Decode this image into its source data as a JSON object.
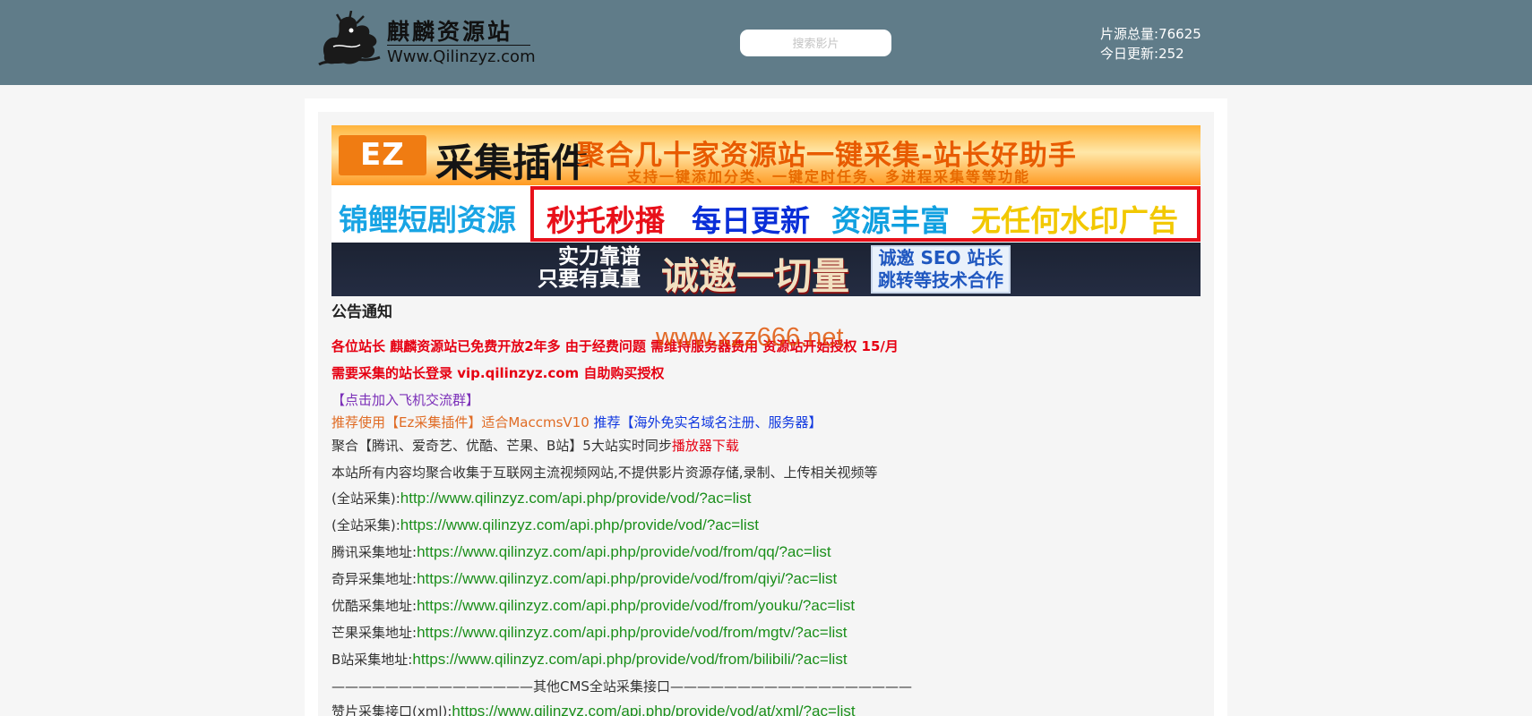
{
  "header": {
    "logo": {
      "title": "麒麟资源站",
      "url": "Www.Qilinzyz.com",
      "icon": "dragon-icon"
    },
    "search": {
      "placeholder": "搜索影片"
    },
    "stats": {
      "total_label": "片源总量:",
      "total_value": "76625",
      "today_label": "今日更新:",
      "today_value": "252"
    }
  },
  "banners": {
    "ez": {
      "logo_text": "EZ",
      "title": "采集插件",
      "slogan": "聚合几十家资源站一键采集-站长好助手",
      "subtitle": "支持一键添加分类、一键定时任务、多进程采集等等功能"
    },
    "jinli": {
      "name": "锦鲤短剧资源",
      "seg1": "秒托秒播",
      "seg2": "每日更新",
      "seg3": "资源丰富",
      "seg4": "无任何水印广告"
    },
    "shili": {
      "line1": "实力靠谱",
      "line2": "只要有真量",
      "main": "诚邀一切量",
      "box_line1": "诚邀 SEO 站长",
      "box_line2": "跳转等技术合作"
    }
  },
  "notice": {
    "title": "公告通知",
    "watermark": "www.xzz666.net",
    "line1": "各位站长 麒麟资源站已免费开放2年多 由于经费问题 需维持服务器费用 资源站开始授权 15/月",
    "line2": "需要采集的站长登录 vip.qilinzyz.com 自助购买授权",
    "telegram_link": "【点击加入飞机交流群】",
    "recommend_ez": "推荐使用【Ez采集插件】适合MaccmsV10",
    "recommend_domain": "推荐【海外免实名域名注册、服务器】",
    "sync_text": "聚合【腾讯、爱奇艺、优酷、芒果、B站】5大站实时同步",
    "player_download": "播放器下载",
    "disclaimer": "本站所有内容均聚合收集于互联网主流视频网站,不提供影片资源存储,录制、上传相关视频等"
  },
  "api_list": [
    {
      "label": "(全站采集):",
      "url": "http://www.qilinzyz.com/api.php/provide/vod/?ac=list"
    },
    {
      "label": "(全站采集):",
      "url": "https://www.qilinzyz.com/api.php/provide/vod/?ac=list"
    },
    {
      "label": "腾讯采集地址:",
      "url": "https://www.qilinzyz.com/api.php/provide/vod/from/qq/?ac=list"
    },
    {
      "label": "奇异采集地址:",
      "url": "https://www.qilinzyz.com/api.php/provide/vod/from/qiyi/?ac=list"
    },
    {
      "label": "优酷采集地址:",
      "url": "https://www.qilinzyz.com/api.php/provide/vod/from/youku/?ac=list"
    },
    {
      "label": "芒果采集地址:",
      "url": "https://www.qilinzyz.com/api.php/provide/vod/from/mgtv/?ac=list"
    },
    {
      "label": "B站采集地址:",
      "url": "https://www.qilinzyz.com/api.php/provide/vod/from/bilibili/?ac=list"
    }
  ],
  "divider": "———————————————其他CMS全站采集接口——————————————————",
  "xml_api": {
    "label": "赞片采集接口(xml):",
    "url": "https://www.qilinzyz.com/api.php/provide/vod/at/xml/?ac=list"
  },
  "colors": {
    "header_bg": "#607c89",
    "link_green": "#1b8f1b",
    "notice_red": "#e60012",
    "accent_orange": "#e06b24",
    "accent_blue": "#1038e0",
    "accent_purple": "#7b2fb8"
  }
}
